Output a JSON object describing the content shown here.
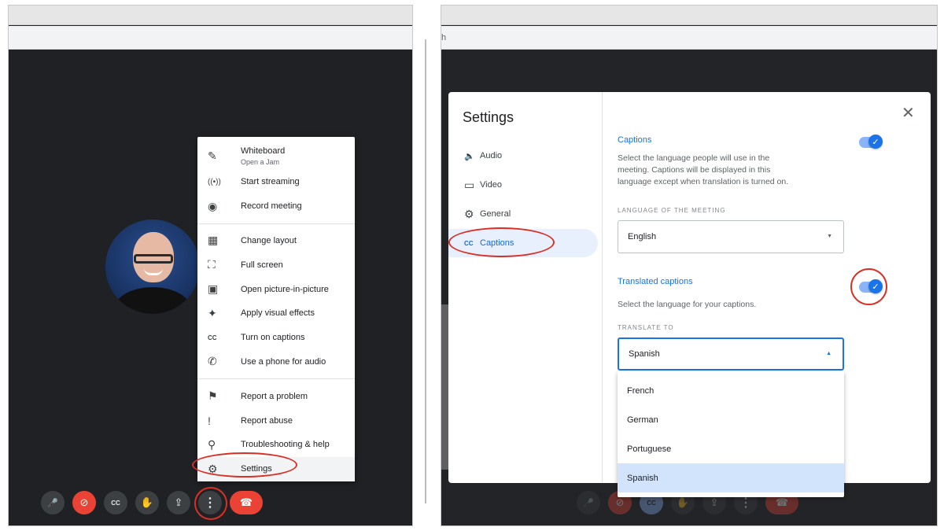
{
  "left": {
    "menu": {
      "items": [
        {
          "label": "Whiteboard",
          "sub": "Open a Jam",
          "icon": "✎"
        },
        {
          "label": "Start streaming",
          "icon": "((•))"
        },
        {
          "label": "Record meeting",
          "icon": "◉"
        },
        {
          "label": "Change layout",
          "icon": "▦"
        },
        {
          "label": "Full screen",
          "icon": "⛶"
        },
        {
          "label": "Open picture-in-picture",
          "icon": "▣"
        },
        {
          "label": "Apply visual effects",
          "icon": "✦"
        },
        {
          "label": "Turn on captions",
          "icon": "CC"
        },
        {
          "label": "Use a phone for audio",
          "icon": "✆"
        },
        {
          "label": "Report a problem",
          "icon": "⚑"
        },
        {
          "label": "Report abuse",
          "icon": "!"
        },
        {
          "label": "Troubleshooting & help",
          "icon": "⚲"
        },
        {
          "label": "Settings",
          "icon": "⚙"
        }
      ]
    },
    "toolbar": {
      "mic": "🎤",
      "camera": "⊘",
      "captions": "CC",
      "hand": "✋",
      "present": "⇪",
      "more": "⋮",
      "end": "☎"
    }
  },
  "right": {
    "chrome_text": "h",
    "settings": {
      "title": "Settings",
      "close": "✕",
      "nav": [
        {
          "label": "Audio",
          "icon": "🔈"
        },
        {
          "label": "Video",
          "icon": "▭"
        },
        {
          "label": "General",
          "icon": "⚙"
        },
        {
          "label": "Captions",
          "icon": "CC"
        }
      ],
      "captions_title": "Captions",
      "captions_desc": "Select the language people will use in the meeting. Captions will be displayed in this language except when translation is turned on.",
      "meeting_lang_label": "LANGUAGE OF THE MEETING",
      "meeting_lang_value": "English",
      "translated_title": "Translated captions",
      "translated_desc": "Select the language for your captions.",
      "translate_label": "TRANSLATE TO",
      "translate_value": "Spanish",
      "options": [
        "French",
        "German",
        "Portuguese",
        "Spanish"
      ],
      "check": "✓",
      "arrow_down": "▼",
      "arrow_up": "▲"
    }
  },
  "colors": {
    "accent": "#1a73e8",
    "highlight": "#d93025",
    "danger": "#ea4335"
  }
}
